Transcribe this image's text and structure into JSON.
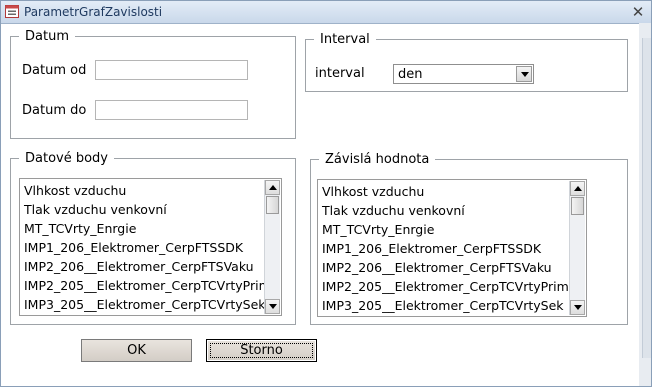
{
  "window": {
    "title": "ParametrGrafZavislosti"
  },
  "datum": {
    "legend": "Datum",
    "from_label": "Datum od",
    "from_value": "",
    "to_label": "Datum do",
    "to_value": ""
  },
  "interval": {
    "legend": "Interval",
    "label": "interval",
    "value": "den"
  },
  "datove_body": {
    "legend": "Datové body",
    "items": [
      "Vlhkost vzduchu",
      "Tlak vzduchu venkovní",
      "MT_TCVrty_Enrgie",
      "IMP1_206_Elektromer_CerpFTSSDK",
      "IMP2_206__Elektromer_CerpFTSVaku",
      "IMP2_205__Elektromer_CerpTCVrtyPrim",
      "IMP3_205__Elektromer_CerpTCVrtySek"
    ]
  },
  "zavisla": {
    "legend": "Závislá hodnota",
    "items": [
      "Vlhkost vzduchu",
      "Tlak vzduchu venkovní",
      "MT_TCVrty_Enrgie",
      "IMP1_206_Elektromer_CerpFTSSDK",
      "IMP2_206__Elektromer_CerpFTSVaku",
      "IMP2_205__Elektromer_CerpTCVrtyPrim",
      "IMP3_205__Elektromer_CerpTCVrtySek"
    ]
  },
  "buttons": {
    "ok": "OK",
    "cancel": "Storno"
  },
  "icons": {
    "app": "form-icon",
    "close": "close-icon"
  }
}
